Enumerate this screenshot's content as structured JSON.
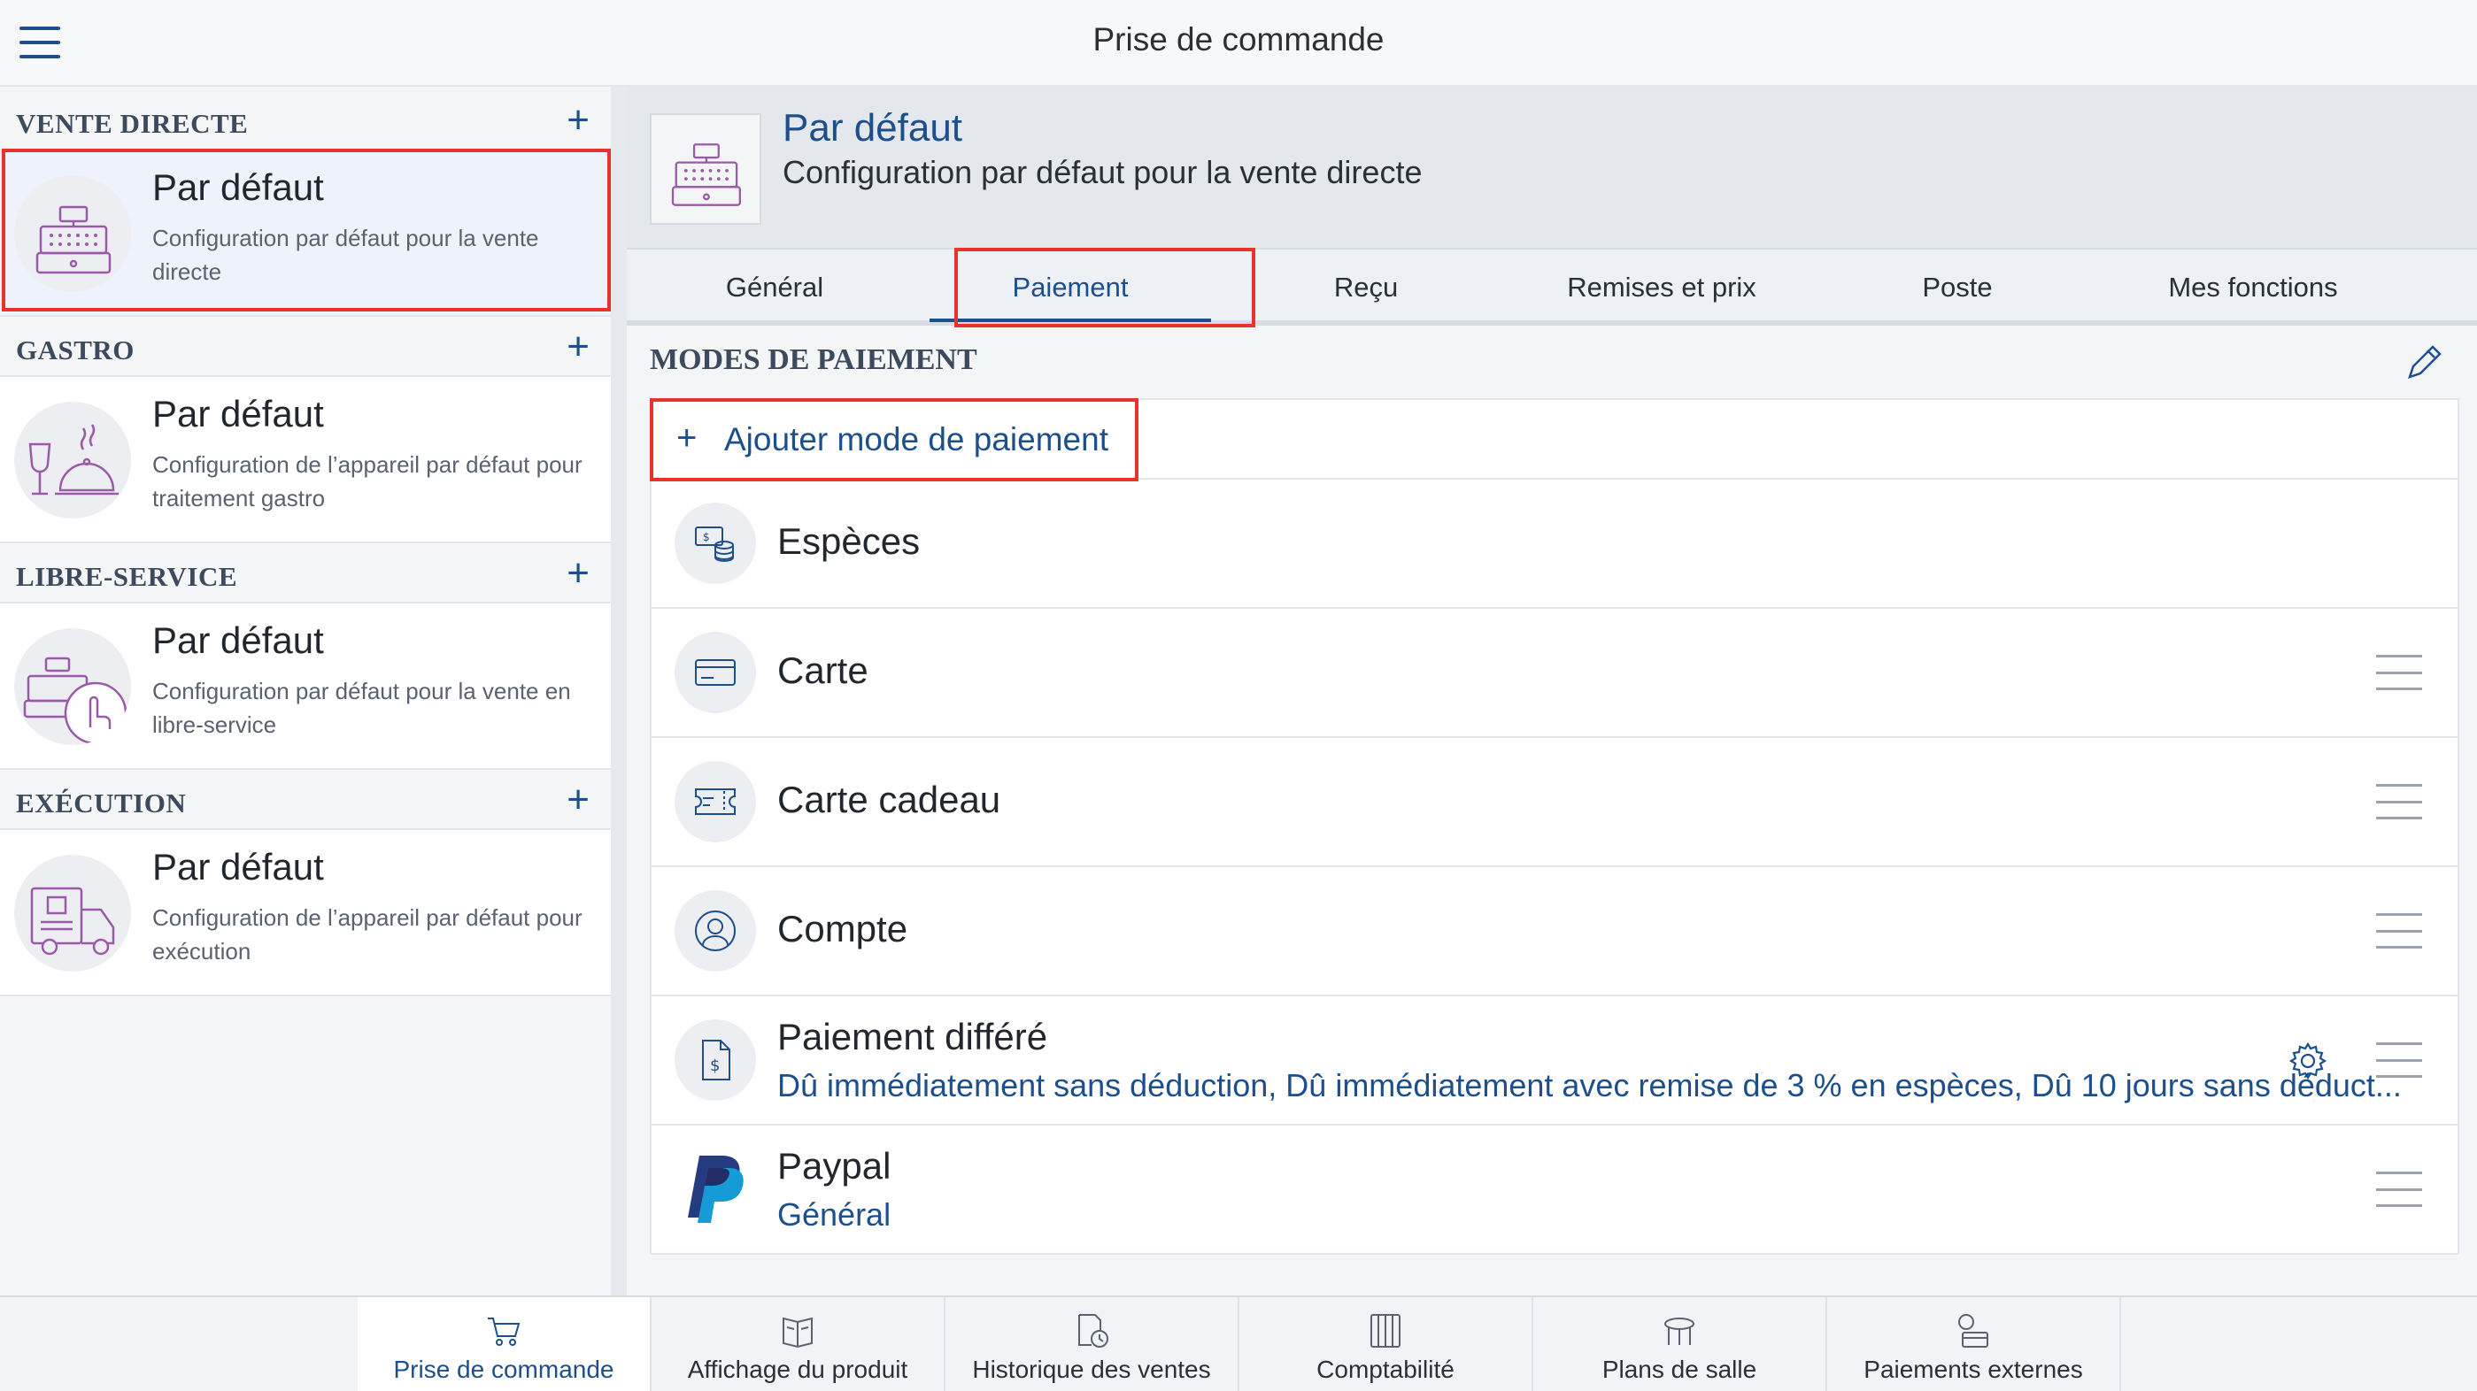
{
  "app": {
    "title": "Prise de commande"
  },
  "sidebar": {
    "sections": [
      {
        "label": "VENTE DIRECTE",
        "card": {
          "title": "Par défaut",
          "desc": "Configuration par défaut pour la vente directe"
        }
      },
      {
        "label": "GASTRO",
        "card": {
          "title": "Par défaut",
          "desc": "Configuration de l’appareil par défaut pour traitement gastro"
        }
      },
      {
        "label": "LIBRE-SERVICE",
        "card": {
          "title": "Par défaut",
          "desc": "Configuration par défaut pour la vente en libre-service"
        }
      },
      {
        "label": "EXÉCUTION",
        "card": {
          "title": "Par défaut",
          "desc": "Configuration de l’appareil par défaut pour exécution"
        }
      }
    ],
    "add_symbol": "+"
  },
  "main": {
    "title": "Par défaut",
    "subtitle": "Configuration par défaut pour la vente directe",
    "tabs": [
      "Général",
      "Paiement",
      "Reçu",
      "Remises et prix",
      "Poste",
      "Mes fonctions"
    ],
    "active_tab": "Paiement",
    "section_title": "MODES DE PAIEMENT",
    "add_label": "Ajouter mode de paiement",
    "payment_modes": [
      {
        "name": "Espèces",
        "icon": "cash-coins-icon"
      },
      {
        "name": "Carte",
        "icon": "credit-card-icon"
      },
      {
        "name": "Carte cadeau",
        "icon": "gift-card-icon"
      },
      {
        "name": "Compte",
        "icon": "account-user-icon"
      },
      {
        "name": "Paiement différé",
        "icon": "invoice-dollar-icon",
        "detail": "Dû immédiatement sans déduction, Dû immédiatement avec remise de 3 % en espèces, Dû 10 jours sans déduct..."
      },
      {
        "name": "Paypal",
        "icon": "paypal-logo",
        "detail": "Général"
      }
    ]
  },
  "bottom_nav": [
    {
      "label": "Prise de commande",
      "icon": "shopping-cart-icon",
      "active": true
    },
    {
      "label": "Affichage du produit",
      "icon": "product-display-icon"
    },
    {
      "label": "Historique des ventes",
      "icon": "sales-history-icon"
    },
    {
      "label": "Comptabilité",
      "icon": "accounting-icon"
    },
    {
      "label": "Plans de salle",
      "icon": "table-plan-icon"
    },
    {
      "label": "Paiements externes",
      "icon": "external-payments-icon"
    }
  ],
  "colors": {
    "accent": "#1d4f8c",
    "highlight": "#e8322c",
    "purple_icon": "#9b5aa8"
  }
}
